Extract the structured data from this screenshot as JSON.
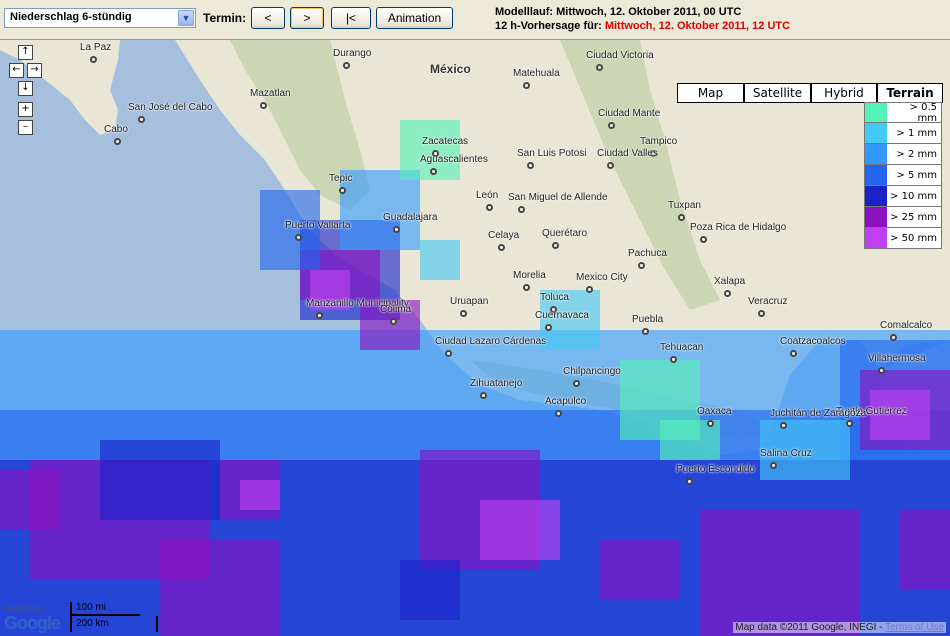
{
  "toolbar": {
    "product_select": "Niederschlag 6-stündig",
    "termin_label": "Termin:",
    "btn_prev": "<",
    "btn_next": ">",
    "btn_first": "|<",
    "btn_animation": "Animation",
    "run_line": "Modelllauf: Mittwoch, 12. Oktober 2011, 00 UTC",
    "forecast_prefix": "12 h-Vorhersage für: ",
    "forecast_time": "Mittwoch, 12. Oktober 2011, 12 UTC"
  },
  "map_types": [
    "Map",
    "Satellite",
    "Hybrid",
    "Terrain"
  ],
  "active_map_type": "Terrain",
  "legend": [
    {
      "label": "> 0.5 mm",
      "color": "#55f2b8"
    },
    {
      "label": "> 1 mm",
      "color": "#44c8f5"
    },
    {
      "label": "> 2 mm",
      "color": "#3399ff"
    },
    {
      "label": "> 5 mm",
      "color": "#2266ee"
    },
    {
      "label": "> 10 mm",
      "color": "#1a22c8"
    },
    {
      "label": "> 25 mm",
      "color": "#8a10c0"
    },
    {
      "label": "> 50 mm",
      "color": "#c040f0"
    }
  ],
  "controls": {
    "up": "↑",
    "left": "←",
    "right": "→",
    "down": "↓",
    "zoom_in": "+",
    "zoom_out": "–"
  },
  "cities": [
    {
      "name": "La Paz"
    },
    {
      "name": "San José del Cabo"
    },
    {
      "name": "Cabo"
    },
    {
      "name": "Mazatlan"
    },
    {
      "name": "Durango"
    },
    {
      "name": "México"
    },
    {
      "name": "Matehuala"
    },
    {
      "name": "Ciudad Victoria"
    },
    {
      "name": "Ciudad Mante"
    },
    {
      "name": "Tampico"
    },
    {
      "name": "Zacatecas"
    },
    {
      "name": "Aguascalientes"
    },
    {
      "name": "San Luis Potosi"
    },
    {
      "name": "Ciudad Valles"
    },
    {
      "name": "Tepic"
    },
    {
      "name": "León"
    },
    {
      "name": "San Miguel de Allende"
    },
    {
      "name": "Guadalajara"
    },
    {
      "name": "Puerto Vallarta"
    },
    {
      "name": "Celaya"
    },
    {
      "name": "Querétaro"
    },
    {
      "name": "Tuxpan"
    },
    {
      "name": "Poza Rica de Hidalgo"
    },
    {
      "name": "Pachuca"
    },
    {
      "name": "Morelia"
    },
    {
      "name": "Mexico City"
    },
    {
      "name": "Xalapa"
    },
    {
      "name": "Veracruz"
    },
    {
      "name": "Manzanillo Municipality"
    },
    {
      "name": "Colima"
    },
    {
      "name": "Uruapan"
    },
    {
      "name": "Toluca"
    },
    {
      "name": "Cuernavaca"
    },
    {
      "name": "Puebla"
    },
    {
      "name": "Tehuacan"
    },
    {
      "name": "Coatzacoalcos"
    },
    {
      "name": "Comalcalco"
    },
    {
      "name": "Villahermosa"
    },
    {
      "name": "Acapulco"
    },
    {
      "name": "Oaxaca"
    },
    {
      "name": "Tuxtla Gutiérrez"
    },
    {
      "name": "Salina Cruz"
    },
    {
      "name": "Puerto Escondido"
    },
    {
      "name": "Zihuatanejo"
    },
    {
      "name": "Chilpancingo"
    },
    {
      "name": "Ciudad Lazaro Cárdenas"
    },
    {
      "name": "Juchitán de Zaragoza"
    }
  ],
  "google_logo": {
    "powered": "POWERED BY",
    "word": "Google"
  },
  "scale": {
    "miles": "100 mi",
    "km": "200 km"
  },
  "attribution": {
    "text": "Map data ©2011 Google, INEGI - ",
    "link": "Terms of Use"
  },
  "colors": {
    "land": "#e9e6d5",
    "sea": "#a5bfdd",
    "mountains": "#c9d3b0"
  }
}
